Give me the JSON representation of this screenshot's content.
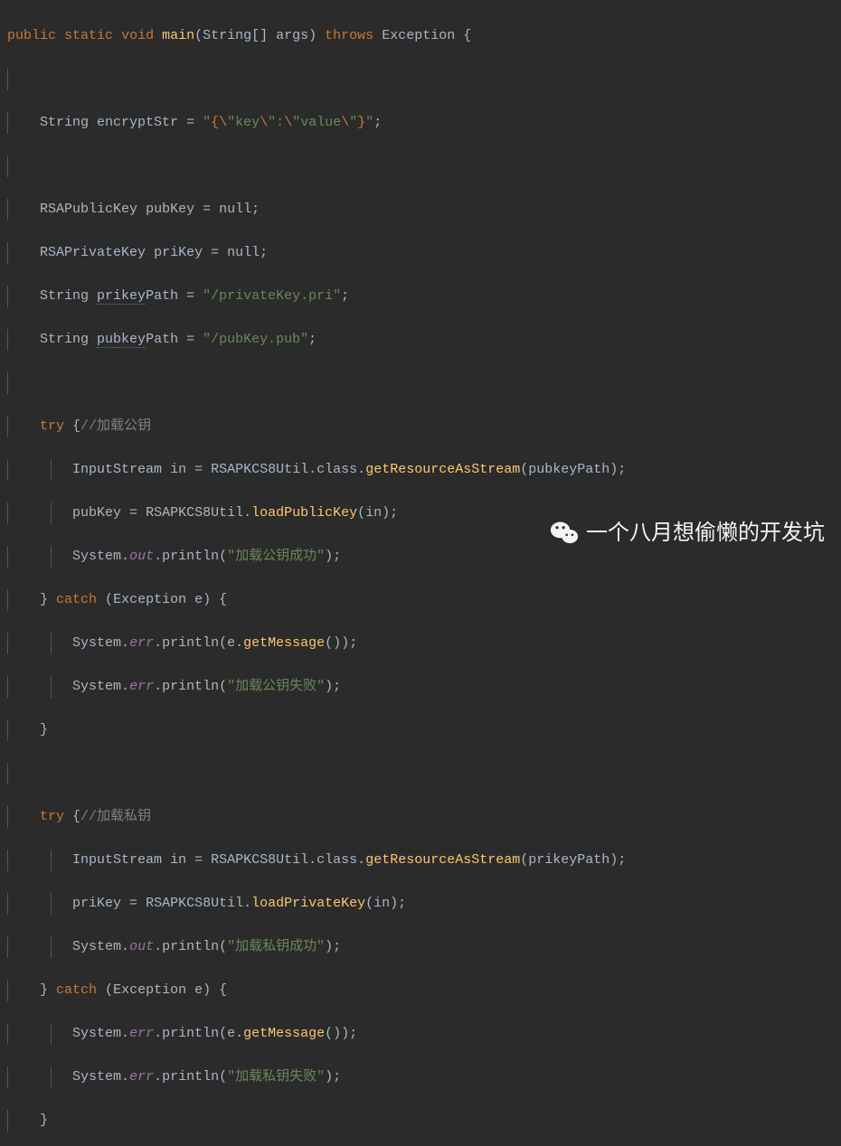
{
  "watermark_text": "一个八月想偷懒的开发坑",
  "code": {
    "l1": {
      "kw1": "public",
      "kw2": "static",
      "kw3": "void",
      "mth": "main",
      "type": "String",
      "args": "[] args)",
      "kw4": "throws",
      "exc": "Exception",
      "brace": " {",
      "lp": "("
    },
    "l3": {
      "type": "String",
      "var": "encryptStr",
      "eq": " = ",
      "q1": "\"",
      "e1": "{\\",
      "q2": "\"",
      "k": "key",
      "e2": "\\",
      "q3": "\"",
      "colon": ":",
      "e3": "\\",
      "q4": "\"",
      "v": "value",
      "e4": "\\",
      "q5": "\"",
      "e5": "}",
      "q6": "\"",
      "semi": ";"
    },
    "l5": {
      "type": "RSAPublicKey",
      "var": "pubKey",
      "rest": " = null;"
    },
    "l6": {
      "type": "RSAPrivateKey",
      "var": "priKey",
      "rest": " = null;"
    },
    "l7": {
      "type": "String",
      "var": "prikey",
      "suf": "Path = ",
      "str": "\"/privateKey.pri\"",
      "semi": ";"
    },
    "l8": {
      "type": "String",
      "var": "pubkey",
      "suf": "Path = ",
      "str": "\"/pubKey.pub\"",
      "semi": ";"
    },
    "l10": {
      "kw": "try",
      "brace": " {",
      "cmt": "//加载公钥"
    },
    "l11": {
      "type": "InputStream",
      "var": "in",
      "eq": " = ",
      "cls": "RSAPKCS8Util",
      "dot1": ".",
      "fld": "class",
      "dot2": ".",
      "mth": "getResourceAsStream",
      "lp": "(",
      "arg": "pubkeyPath",
      "rp": ");"
    },
    "l12": {
      "var": "pubKey",
      "eq": " = ",
      "cls": "RSAPKCS8Util",
      "dot": ".",
      "mth": "loadPublicKey",
      "lp": "(",
      "arg": "in",
      "rp": ");"
    },
    "l13": {
      "cls": "System",
      "dot1": ".",
      "fld": "out",
      "dot2": ".",
      "mth": "println",
      "lp": "(",
      "str": "\"加载公钥成功\"",
      "rp": ");"
    },
    "l14": {
      "rb": "}",
      "kw": " catch ",
      "lp": "(",
      "type": "Exception",
      "var": " e)",
      "brace": " {"
    },
    "l15": {
      "cls": "System",
      "dot1": ".",
      "fld": "err",
      "dot2": ".",
      "mth": "println",
      "lp": "(",
      "arg": "e",
      "dot3": ".",
      "mth2": "getMessage",
      "pp": "()",
      "rp": ");"
    },
    "l16": {
      "cls": "System",
      "dot1": ".",
      "fld": "err",
      "dot2": ".",
      "mth": "println",
      "lp": "(",
      "str": "\"加载公钥失败\"",
      "rp": ");"
    },
    "l17": {
      "rb": "}"
    },
    "l19": {
      "kw": "try",
      "brace": " {",
      "cmt": "//加载私钥"
    },
    "l20": {
      "type": "InputStream",
      "var": "in",
      "eq": " = ",
      "cls": "RSAPKCS8Util",
      "dot1": ".",
      "fld": "class",
      "dot2": ".",
      "mth": "getResourceAsStream",
      "lp": "(",
      "arg": "prikeyPath",
      "rp": ");"
    },
    "l21": {
      "var": "priKey",
      "eq": " = ",
      "cls": "RSAPKCS8Util",
      "dot": ".",
      "mth": "loadPrivateKey",
      "lp": "(",
      "arg": "in",
      "rp": ");"
    },
    "l22": {
      "cls": "System",
      "dot1": ".",
      "fld": "out",
      "dot2": ".",
      "mth": "println",
      "lp": "(",
      "str": "\"加载私钥成功\"",
      "rp": ");"
    },
    "l23": {
      "rb": "}",
      "kw": " catch ",
      "lp": "(",
      "type": "Exception",
      "var": " e)",
      "brace": " {"
    },
    "l24": {
      "cls": "System",
      "dot1": ".",
      "fld": "err",
      "dot2": ".",
      "mth": "println",
      "lp": "(",
      "arg": "e",
      "dot3": ".",
      "mth2": "getMessage",
      "pp": "()",
      "rp": ");"
    },
    "l25": {
      "cls": "System",
      "dot1": ".",
      "fld": "err",
      "dot2": ".",
      "mth": "println",
      "lp": "(",
      "str": "\"加载私钥失败\"",
      "rp": ");"
    },
    "l26": {
      "rb": "}"
    }
  }
}
